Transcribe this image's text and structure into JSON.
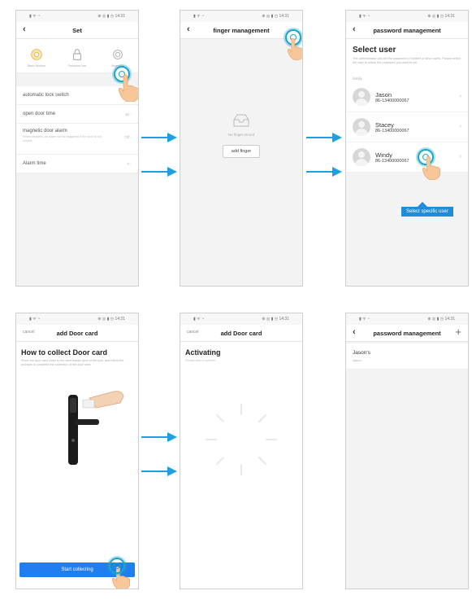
{
  "status_bar": {
    "left": "▮ ᯤ ◔",
    "right": "⊕ ◎ ▮ ◷ 14:31"
  },
  "colors": {
    "arrow": "#1e9fe0",
    "accent_blue": "#1f7ff0",
    "toggle": "#3fb950",
    "tap": "#19a7c9",
    "callout": "#1e8cd6"
  },
  "screen1": {
    "title": "Set",
    "icons": [
      {
        "name": "gear-icon",
        "label": "Basic function"
      },
      {
        "name": "lock-icon",
        "label": "Password lock"
      },
      {
        "name": "fingerprint-icon",
        "label": "fingerprint"
      }
    ],
    "rows": [
      {
        "label": "automatic lock switch",
        "value": ""
      },
      {
        "label": "open door time",
        "value": "5s ›"
      },
      {
        "label": "magnetic door alarm",
        "value": "Off ›"
      },
      {
        "label": "Alarm time",
        "value": "0 ›"
      }
    ],
    "alarm_desc": "When enabled, an alarm will be triggered if the door is not closed."
  },
  "screen2": {
    "title": "finger management",
    "empty_text": "No finger record",
    "add_button": "add finger"
  },
  "screen3": {
    "title": "password management",
    "heading": "Select user",
    "description": "The administrator can set the password of himself or other users. Please select the user to whom the password you want to set.",
    "section": "family",
    "users": [
      {
        "name": "Jason",
        "phone": "86-13400000067"
      },
      {
        "name": "Stacey",
        "phone": "86-13400000067"
      },
      {
        "name": "Windy",
        "phone": "86-13400000067"
      }
    ],
    "callout": "Select specific user"
  },
  "screen4": {
    "cancel": "cancel",
    "title": "add Door card",
    "heading": "How to collect Door card",
    "description": "Place the door card close to the card reader area of the lock, and follow the prompts to complete the collection of the door card.",
    "button": "Start collecting"
  },
  "screen5": {
    "cancel": "cancel",
    "title": "add Door card",
    "heading": "Activating",
    "subtitle": "Please wait a moment..."
  },
  "screen6": {
    "title": "password management",
    "item_title": "Jason's",
    "item_sub": "Jason"
  }
}
